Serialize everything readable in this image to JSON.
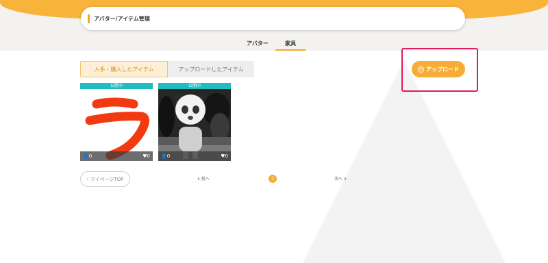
{
  "header": {
    "title": "アバター/アイテム管理"
  },
  "main_tabs": [
    {
      "label": "アバター"
    },
    {
      "label": "家具"
    }
  ],
  "sub_tabs": [
    {
      "label": "入手・購入したアイテム"
    },
    {
      "label": "アップロードしたアイテム"
    }
  ],
  "upload": {
    "label": "アップロード",
    "icon": "plus-circle-icon"
  },
  "items": [
    {
      "status": "公開中",
      "uses": "0",
      "likes": "0",
      "thumb_glyph": "ラ"
    },
    {
      "status": "公開中",
      "uses": "0",
      "likes": "0"
    }
  ],
  "pagination": {
    "prev": "前へ",
    "current": "1",
    "next": "次へ"
  },
  "mypage": {
    "label": "マイページTOP"
  },
  "colors": {
    "accent": "#f7ac37",
    "status": "#1fbdbf",
    "highlight": "#e2195b"
  }
}
